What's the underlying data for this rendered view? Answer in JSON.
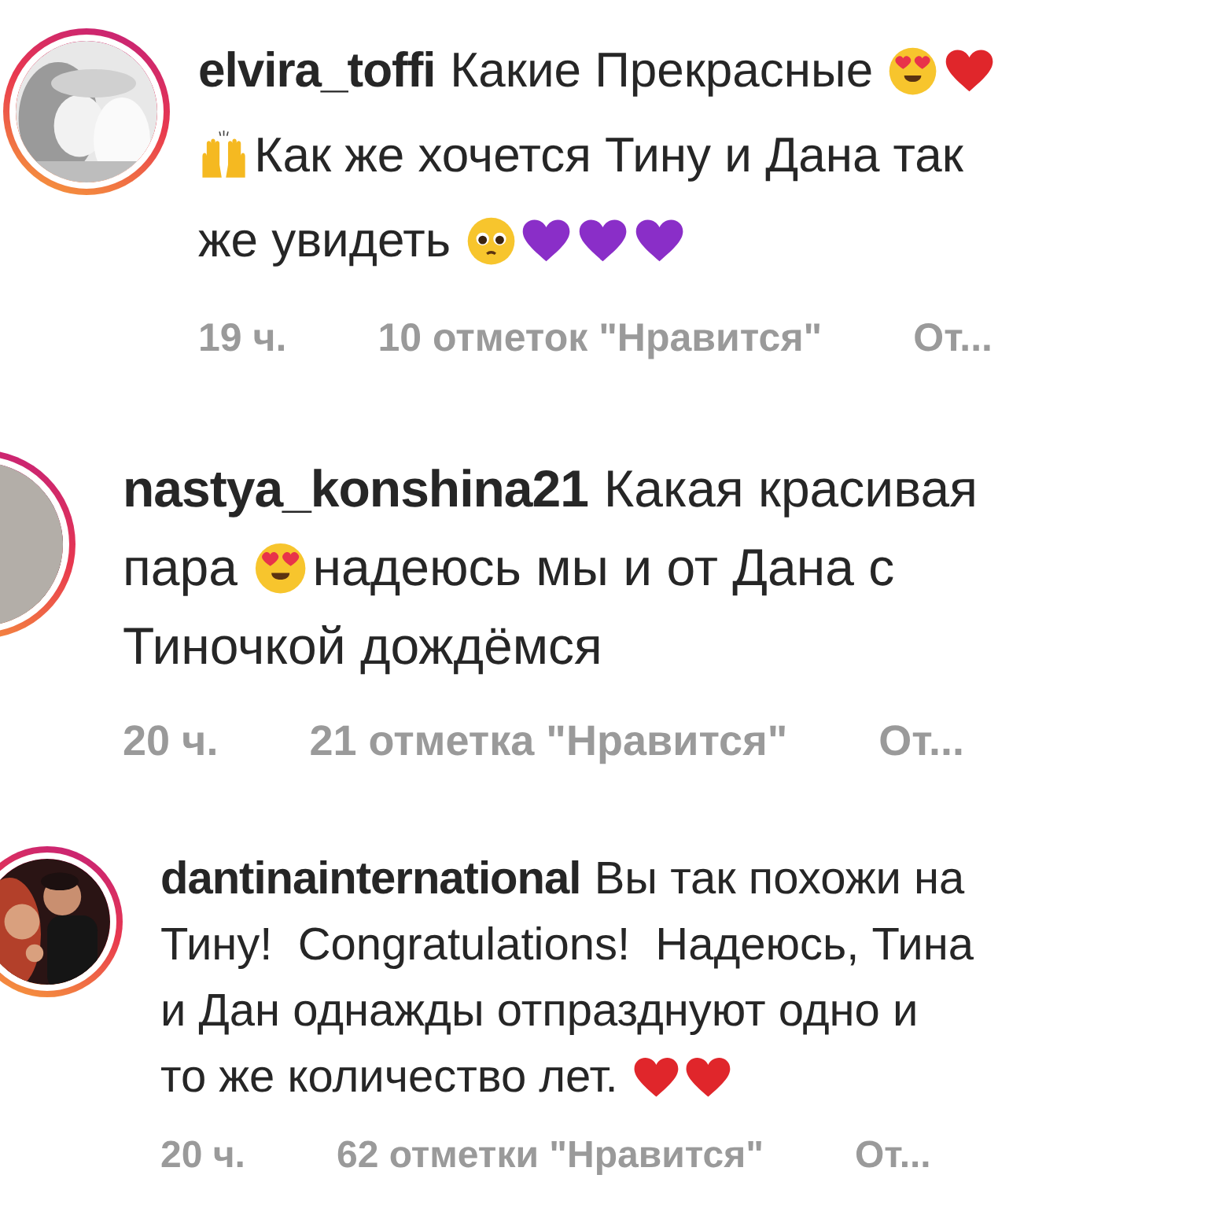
{
  "comments": [
    {
      "username": "elvira_toffi",
      "avatar": {
        "kind": "picture"
      },
      "lines": [
        [
          {
            "kind": "text",
            "text": "Какие Прекрасные"
          },
          {
            "kind": "heart-eyes"
          },
          {
            "kind": "heart",
            "color": "#e0262b"
          }
        ],
        [
          {
            "kind": "raised-hands"
          },
          {
            "kind": "text",
            "text": "Как же хочется Тину и Дана так"
          }
        ],
        [
          {
            "kind": "text",
            "text": "же увидеть"
          },
          {
            "kind": "pleading"
          },
          {
            "kind": "heart",
            "color": "#8a2ec8"
          },
          {
            "kind": "heart",
            "color": "#8a2ec8"
          },
          {
            "kind": "heart",
            "color": "#8a2ec8"
          }
        ]
      ],
      "time": "19 ч.",
      "likes": "10 отметок \"Нравится\"",
      "reply": "От..."
    },
    {
      "username": "nastya_konshina21",
      "avatar": {
        "kind": "picture"
      },
      "lines": [
        [
          {
            "kind": "text",
            "text": "Какая красивая"
          }
        ],
        [
          {
            "kind": "text",
            "text": "пара"
          },
          {
            "kind": "heart-eyes"
          },
          {
            "kind": "text",
            "text": "надеюсь мы и от Дана с"
          }
        ],
        [
          {
            "kind": "text",
            "text": "Тиночкой дождёмся"
          }
        ]
      ],
      "time": "20 ч.",
      "likes": "21 отметка \"Нравится\"",
      "reply": "От..."
    },
    {
      "username": "dantinainternational",
      "avatar": {
        "kind": "picture"
      },
      "lines": [
        [
          {
            "kind": "text",
            "text": "Вы так похожи на"
          }
        ],
        [
          {
            "kind": "text",
            "text": "Тину!  Congratulations!  Надеюсь, Тина"
          }
        ],
        [
          {
            "kind": "text",
            "text": "и Дан однажды отпразднуют одно и"
          }
        ],
        [
          {
            "kind": "text",
            "text": "то же количество лет."
          },
          {
            "kind": "heart",
            "color": "#e0262b"
          },
          {
            "kind": "heart",
            "color": "#e0262b"
          }
        ]
      ],
      "time": "20 ч.",
      "likes": "62 отметки \"Нравится\"",
      "reply": "От..."
    }
  ]
}
